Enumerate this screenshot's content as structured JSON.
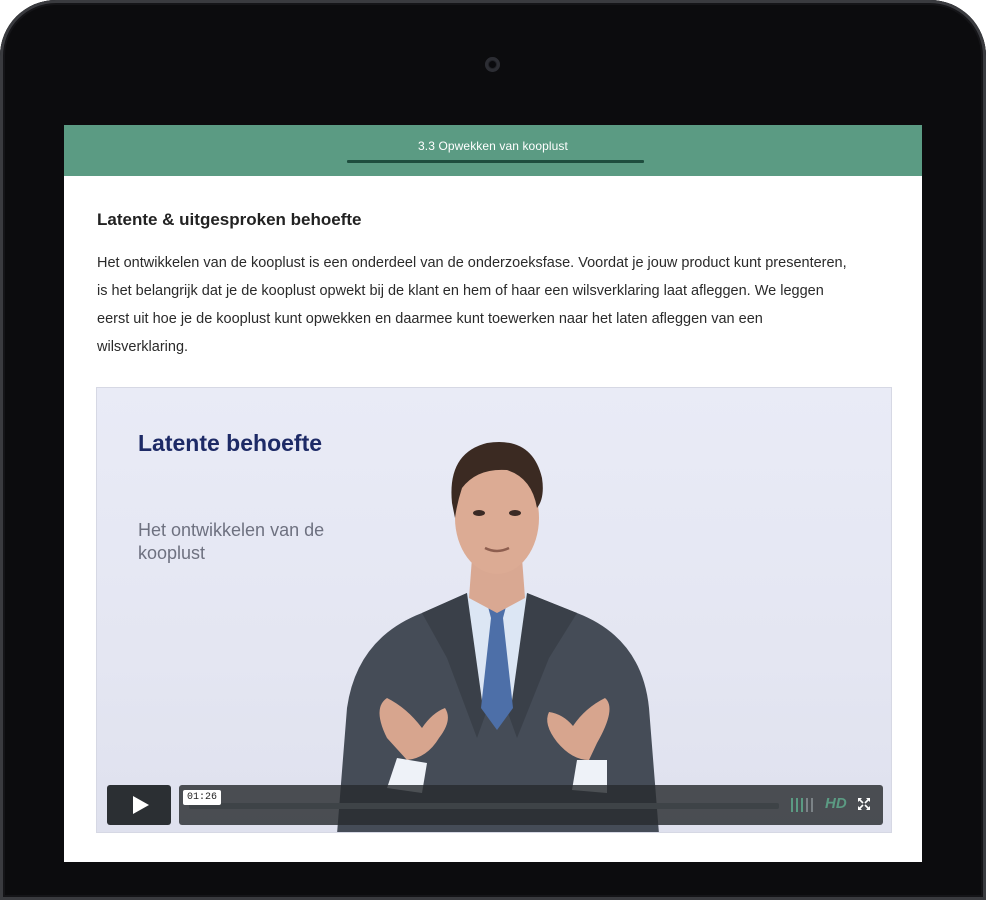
{
  "header": {
    "title": "3.3 Opwekken van kooplust",
    "progress": 1.0
  },
  "content": {
    "heading": "Latente & uitgesproken behoefte",
    "intro": "Het ontwikkelen van de kooplust is een onderdeel van de onderzoeksfase. Voordat je jouw product kunt presenteren, is het belangrijk dat je de kooplust opwekt bij de klant en hem of haar een wilsverklaring laat afleggen. We leggen eerst uit hoe je de kooplust kunt opwekken en daarmee kunt toewerken naar het laten afleggen van een wilsverklaring."
  },
  "video": {
    "slide_title": "Latente behoefte",
    "slide_subtitle": "Het ontwikkelen van de kooplust",
    "time": "01:26",
    "hd_label": "HD",
    "play_icon": "play-icon",
    "fullscreen_icon": "fullscreen-icon",
    "volume_icon": "volume-icon"
  },
  "colors": {
    "accent": "#5b9b83",
    "progress": "#1e4d3e",
    "slide_title": "#1d2a66"
  }
}
